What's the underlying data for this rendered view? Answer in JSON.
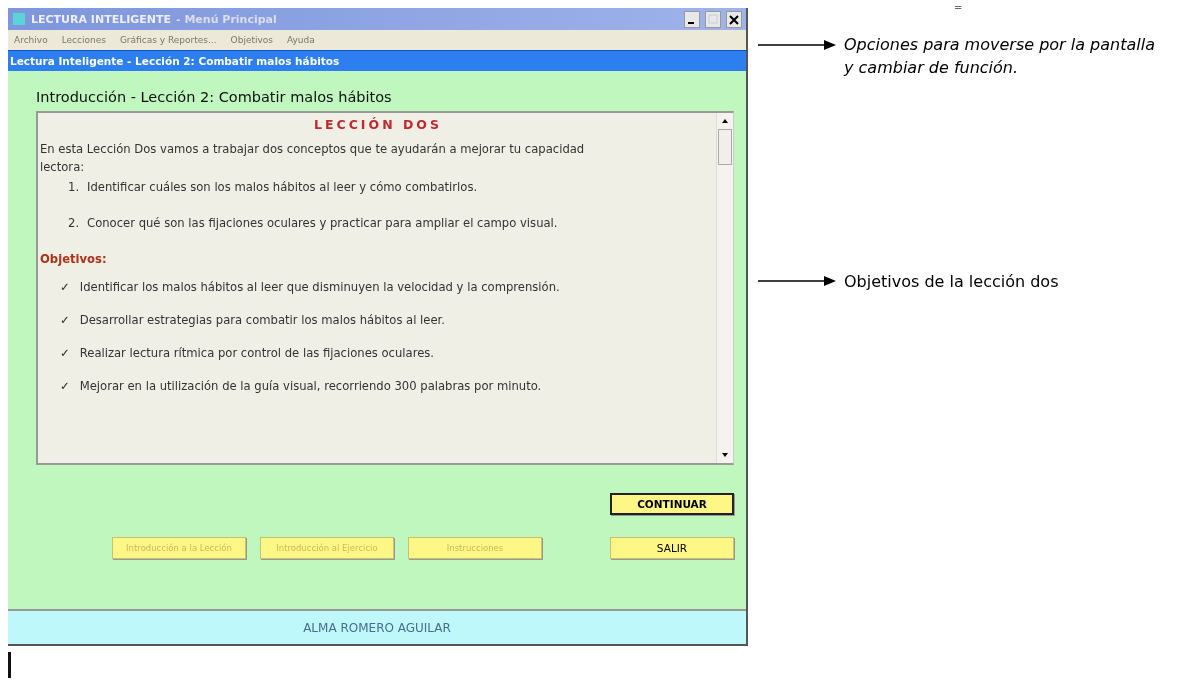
{
  "window": {
    "title_app": "LECTURA INTELIGENTE",
    "title_rest": " - Menú Principal"
  },
  "menu": [
    {
      "label": "Archivo",
      "disabled": true
    },
    {
      "label": "Lecciones",
      "disabled": true
    },
    {
      "label": "Gráficas y Reportes...",
      "disabled": true
    },
    {
      "label": "Objetivos",
      "disabled": true
    },
    {
      "label": "Ayuda",
      "disabled": true
    }
  ],
  "subtitle": "Lectura Inteligente - Lección 2: Combatir malos hábitos",
  "heading": "Introducción - Lección 2: Combatir malos hábitos",
  "lesson": {
    "title": "LECCIÓN DOS",
    "intro": "En esta Lección Dos vamos a trabajar dos conceptos que te ayudarán a mejorar tu capacidad lectora:",
    "steps": [
      {
        "number": "1.",
        "text": "Identificar cuáles son los malos hábitos al leer y cómo combatirlos."
      },
      {
        "number": "2.",
        "text": "Conocer qué son las fijaciones oculares y practicar para ampliar el campo visual."
      }
    ],
    "objectives_title": "Objetivos:",
    "objectives": [
      {
        "mark": "✓",
        "text": "Identificar los malos hábitos al leer que disminuyen la velocidad y la comprensión."
      },
      {
        "mark": "✓",
        "text": "Desarrollar estrategias para combatir los malos hábitos al leer."
      },
      {
        "mark": "✓",
        "text": "Realizar lectura rítmica por control de las fijaciones oculares."
      },
      {
        "mark": "✓",
        "text": "Mejorar en la utilización de la guía visual, recorriendo 300 palabras por minuto."
      }
    ]
  },
  "primary_button": {
    "label": "CONTINUAR",
    "disabled": false,
    "focused": true
  },
  "buttons": [
    {
      "label": "Introducción a la Lección",
      "disabled": true,
      "focused": false
    },
    {
      "label": "Introducción al Ejercicio",
      "disabled": true,
      "focused": false
    },
    {
      "label": "Instrucciones",
      "disabled": true,
      "focused": false
    },
    {
      "label": "SALIR",
      "disabled": false,
      "focused": false
    }
  ],
  "footer": "ALMA  ROMERO AGUILAR",
  "stray_mark": "=",
  "annotations": [
    {
      "text": "Opciones para moverse por la pantalla y cambiar de función.",
      "italic": true
    },
    {
      "text": "Objetivos de la lección dos",
      "italic": false
    }
  ]
}
